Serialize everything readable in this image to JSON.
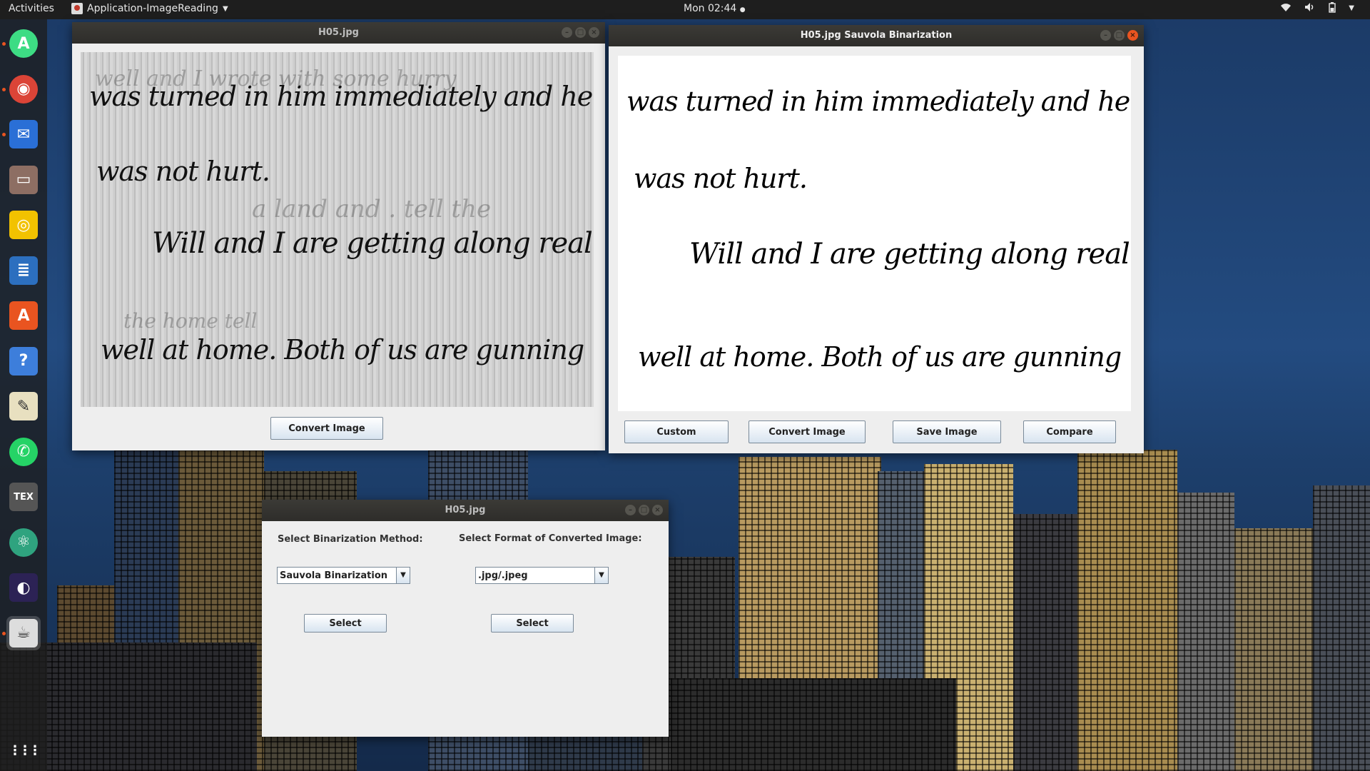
{
  "topbar": {
    "activities": "Activities",
    "app_name": "Application-ImageReading",
    "clock": "Mon 02:44",
    "clock_dot": "●"
  },
  "dock": {
    "items": [
      {
        "icon": "android-studio-icon",
        "glyph": "A",
        "color": "#3ddc84"
      },
      {
        "icon": "chrome-icon",
        "glyph": "◉",
        "color": "#db4437"
      },
      {
        "icon": "thunderbird-icon",
        "glyph": "✉",
        "color": "#2a6fd6"
      },
      {
        "icon": "files-icon",
        "glyph": "▭",
        "color": "#8d6e63"
      },
      {
        "icon": "rhythmbox-icon",
        "glyph": "◎",
        "color": "#f2c200"
      },
      {
        "icon": "writer-icon",
        "glyph": "≣",
        "color": "#2c6fbf"
      },
      {
        "icon": "software-center-icon",
        "glyph": "A",
        "color": "#e95420"
      },
      {
        "icon": "help-icon",
        "glyph": "?",
        "color": "#3d7edb"
      },
      {
        "icon": "text-editor-icon",
        "glyph": "✎",
        "color": "#e8e0c0"
      },
      {
        "icon": "whatsapp-icon",
        "glyph": "✆",
        "color": "#25d366"
      },
      {
        "icon": "texmaker-icon",
        "glyph": "TEX",
        "color": "#555"
      },
      {
        "icon": "atom-icon",
        "glyph": "⚛",
        "color": "#2fa37f"
      },
      {
        "icon": "eclipse-icon",
        "glyph": "◐",
        "color": "#2c2255"
      },
      {
        "icon": "java-app-icon",
        "glyph": "☕",
        "color": "#ddd"
      }
    ],
    "show_apps_glyph": "⋮⋮⋮"
  },
  "window_original": {
    "title": "H05.jpg",
    "convert_label": "Convert Image",
    "lines": [
      "was turned in him immediately and he",
      "was not hurt.",
      "Will and I are getting along real",
      "well at home. Both of us are gunning"
    ]
  },
  "window_binarized": {
    "title": "H05.jpg Sauvola Binarization",
    "buttons": {
      "custom": "Custom",
      "convert": "Convert Image",
      "save": "Save Image",
      "compare": "Compare"
    }
  },
  "window_settings": {
    "title": "H05.jpg",
    "method_label": "Select Binarization Method:",
    "format_label": "Select Format of Converted Image:",
    "method_value": "Sauvola Binarization",
    "format_value": ".jpg/.jpeg",
    "select_method_label": "Select",
    "select_format_label": "Select"
  },
  "tray": {
    "wifi": "wifi-icon",
    "volume": "volume-icon",
    "battery": "battery-icon",
    "menu": "chevron-down-icon"
  }
}
